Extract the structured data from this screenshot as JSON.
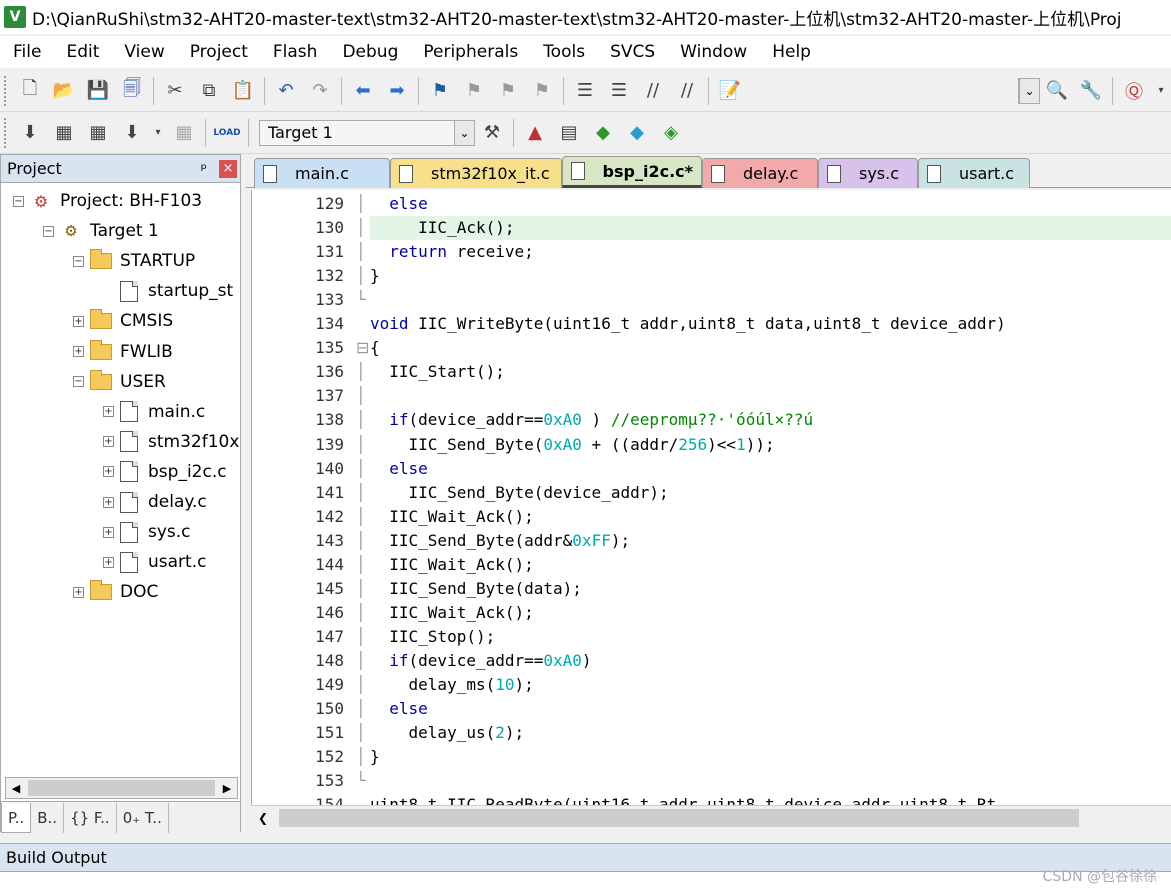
{
  "window": {
    "title": "D:\\QianRuShi\\stm32-AHT20-master-text\\stm32-AHT20-master-text\\stm32-AHT20-master-上位机\\stm32-AHT20-master-上位机\\Proj",
    "app_icon": "V"
  },
  "menu": [
    "File",
    "Edit",
    "View",
    "Project",
    "Flash",
    "Debug",
    "Peripherals",
    "Tools",
    "SVCS",
    "Window",
    "Help"
  ],
  "toolbar2": {
    "target": "Target 1"
  },
  "project_panel": {
    "title": "Project",
    "pin": "ᵖ",
    "close": "×",
    "tree": [
      {
        "label": "Project: BH-F103",
        "level": 0,
        "type": "project",
        "exp": "−"
      },
      {
        "label": "Target 1",
        "level": 1,
        "type": "target",
        "exp": "−"
      },
      {
        "label": "STARTUP",
        "level": 2,
        "type": "folder",
        "exp": "−"
      },
      {
        "label": "startup_st",
        "level": 3,
        "type": "file",
        "exp": ""
      },
      {
        "label": "CMSIS",
        "level": 2,
        "type": "folder",
        "exp": "+"
      },
      {
        "label": "FWLIB",
        "level": 2,
        "type": "folder",
        "exp": "+"
      },
      {
        "label": "USER",
        "level": 2,
        "type": "folder",
        "exp": "−"
      },
      {
        "label": "main.c",
        "level": 3,
        "type": "file",
        "exp": "+"
      },
      {
        "label": "stm32f10x",
        "level": 3,
        "type": "file",
        "exp": "+"
      },
      {
        "label": "bsp_i2c.c",
        "level": 3,
        "type": "file",
        "exp": "+"
      },
      {
        "label": "delay.c",
        "level": 3,
        "type": "file",
        "exp": "+"
      },
      {
        "label": "sys.c",
        "level": 3,
        "type": "file",
        "exp": "+"
      },
      {
        "label": "usart.c",
        "level": 3,
        "type": "file",
        "exp": "+"
      },
      {
        "label": "DOC",
        "level": 2,
        "type": "folder",
        "exp": "+"
      }
    ],
    "bottom_tabs": [
      "P..",
      "B..",
      "{} F..",
      "0₊ T.."
    ]
  },
  "editor_tabs": [
    {
      "label": "main.c",
      "color": "#c9dff3"
    },
    {
      "label": "stm32f10x_it.c",
      "color": "#f8e08a"
    },
    {
      "label": "bsp_i2c.c*",
      "color": "#d7e6c4",
      "active": true
    },
    {
      "label": "delay.c",
      "color": "#f3a9a9"
    },
    {
      "label": "sys.c",
      "color": "#d6c2ea"
    },
    {
      "label": "usart.c",
      "color": "#c9e3e3"
    }
  ],
  "code": {
    "current_line": 130,
    "lines": [
      {
        "n": 129,
        "f": "│",
        "c": [
          [
            "kw",
            "  else"
          ]
        ]
      },
      {
        "n": 130,
        "f": "│",
        "c": [
          [
            "",
            "     IIC_Ack();"
          ]
        ]
      },
      {
        "n": 131,
        "f": "│",
        "c": [
          [
            "kw",
            "  return"
          ],
          [
            "",
            " receive;"
          ]
        ]
      },
      {
        "n": 132,
        "f": "│",
        "c": [
          [
            "",
            "}"
          ]
        ]
      },
      {
        "n": 133,
        "f": "└",
        "c": []
      },
      {
        "n": 134,
        "f": "",
        "c": [
          [
            "kw",
            "void"
          ],
          [
            "",
            " IIC_WriteByte(uint16_t addr,uint8_t data,uint8_t device_addr)"
          ]
        ]
      },
      {
        "n": 135,
        "f": "⊟",
        "c": [
          [
            "",
            "{"
          ]
        ]
      },
      {
        "n": 136,
        "f": "│",
        "c": [
          [
            "",
            "  IIC_Start();"
          ]
        ]
      },
      {
        "n": 137,
        "f": "│",
        "c": []
      },
      {
        "n": 138,
        "f": "│",
        "c": [
          [
            "kw",
            "  if"
          ],
          [
            "",
            "(device_addr=="
          ],
          [
            "num",
            "0xA0"
          ],
          [
            "",
            " ) "
          ],
          [
            "cm",
            "//eepromμ??·'óóúl×??ú"
          ]
        ]
      },
      {
        "n": 139,
        "f": "│",
        "c": [
          [
            "",
            "    IIC_Send_Byte("
          ],
          [
            "num",
            "0xA0"
          ],
          [
            "",
            " + ((addr/"
          ],
          [
            "num",
            "256"
          ],
          [
            "",
            ")<<"
          ],
          [
            "num",
            "1"
          ],
          [
            "",
            "));"
          ]
        ]
      },
      {
        "n": 140,
        "f": "│",
        "c": [
          [
            "kw",
            "  else"
          ]
        ]
      },
      {
        "n": 141,
        "f": "│",
        "c": [
          [
            "",
            "    IIC_Send_Byte(device_addr);"
          ]
        ]
      },
      {
        "n": 142,
        "f": "│",
        "c": [
          [
            "",
            "  IIC_Wait_Ack();"
          ]
        ]
      },
      {
        "n": 143,
        "f": "│",
        "c": [
          [
            "",
            "  IIC_Send_Byte(addr&"
          ],
          [
            "num",
            "0xFF"
          ],
          [
            "",
            ");"
          ]
        ]
      },
      {
        "n": 144,
        "f": "│",
        "c": [
          [
            "",
            "  IIC_Wait_Ack();"
          ]
        ]
      },
      {
        "n": 145,
        "f": "│",
        "c": [
          [
            "",
            "  IIC_Send_Byte(data);"
          ]
        ]
      },
      {
        "n": 146,
        "f": "│",
        "c": [
          [
            "",
            "  IIC_Wait_Ack();"
          ]
        ]
      },
      {
        "n": 147,
        "f": "│",
        "c": [
          [
            "",
            "  IIC_Stop();"
          ]
        ]
      },
      {
        "n": 148,
        "f": "│",
        "c": [
          [
            "kw",
            "  if"
          ],
          [
            "",
            "(device_addr=="
          ],
          [
            "num",
            "0xA0"
          ],
          [
            "",
            ")"
          ]
        ]
      },
      {
        "n": 149,
        "f": "│",
        "c": [
          [
            "",
            "    delay_ms("
          ],
          [
            "num",
            "10"
          ],
          [
            "",
            ");"
          ]
        ]
      },
      {
        "n": 150,
        "f": "│",
        "c": [
          [
            "kw",
            "  else"
          ]
        ]
      },
      {
        "n": 151,
        "f": "│",
        "c": [
          [
            "",
            "    delay_us("
          ],
          [
            "num",
            "2"
          ],
          [
            "",
            ");"
          ]
        ]
      },
      {
        "n": 152,
        "f": "│",
        "c": [
          [
            "",
            "}"
          ]
        ]
      },
      {
        "n": 153,
        "f": "└",
        "c": []
      },
      {
        "n": 154,
        "f": "",
        "c": [
          [
            "",
            "uint8_t IIC_ReadByte(uint16_t addr,uint8_t device_addr,uint8_t Rt"
          ]
        ]
      }
    ]
  },
  "build_output": {
    "title": "Build Output"
  },
  "watermark": "CSDN @包谷徐徐"
}
